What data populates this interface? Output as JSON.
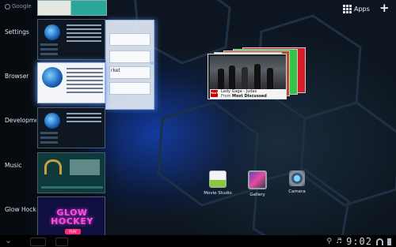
{
  "topbar": {
    "search_hint": "Google",
    "apps_label": "Apps",
    "add_label": "+"
  },
  "recents": [
    {
      "label": "Settings"
    },
    {
      "label": "Browser",
      "overlay_text": "rket"
    },
    {
      "label": "Developme"
    },
    {
      "label": "Music"
    },
    {
      "label": "Glow Hocke",
      "thumb_title": "GLOW HOCKEY",
      "thumb_button": "PLAY"
    }
  ],
  "widget": {
    "source": "YouTube",
    "video_title": "Lady Gaga - Judas",
    "from_prefix": "From",
    "from_channel": "Most Discussed"
  },
  "shortcuts": [
    {
      "label": "Movie Studio",
      "icon": "movie-studio-icon"
    },
    {
      "label": "Gallery",
      "icon": "gallery-icon"
    },
    {
      "label": "Camera",
      "icon": "camera-icon"
    }
  ],
  "statusbar": {
    "time": "9:02"
  },
  "colors": {
    "accent_glow": "#6aa0ff",
    "background": "#0b121b"
  }
}
